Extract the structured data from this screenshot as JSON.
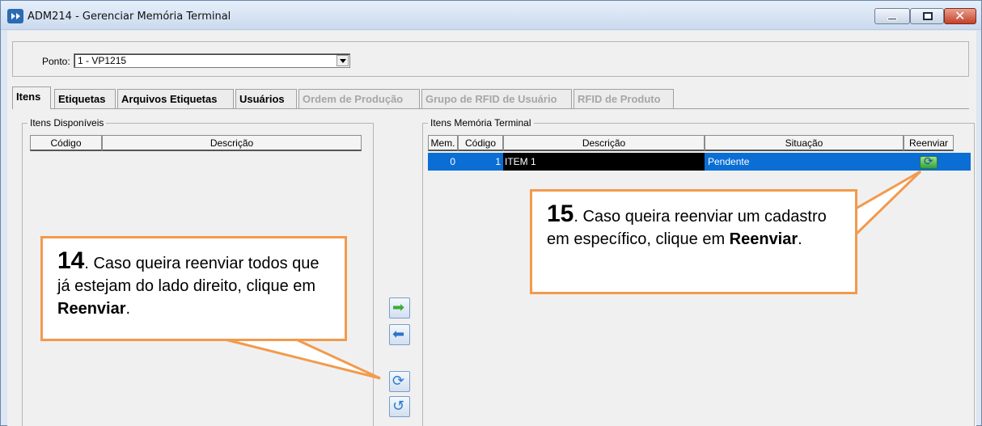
{
  "window": {
    "title": "ADM214 - Gerenciar Memória Terminal",
    "buttons": {
      "minimize": "minimize-icon",
      "maximize": "maximize-icon",
      "close": "close-icon"
    }
  },
  "ponto": {
    "label": "Ponto:",
    "selected": "1 - VP1215"
  },
  "tabs": [
    {
      "label": "Itens",
      "active": true,
      "disabled": false
    },
    {
      "label": "Etiquetas",
      "active": false,
      "disabled": false
    },
    {
      "label": "Arquivos Etiquetas",
      "active": false,
      "disabled": false
    },
    {
      "label": "Usuários",
      "active": false,
      "disabled": false
    },
    {
      "label": "Ordem de Produção",
      "active": false,
      "disabled": true
    },
    {
      "label": "Grupo de RFID de Usuário",
      "active": false,
      "disabled": true
    },
    {
      "label": "RFID de Produto",
      "active": false,
      "disabled": true
    }
  ],
  "left_panel": {
    "title": "Itens Disponíveis",
    "columns": [
      "Código",
      "Descrição"
    ],
    "rows": []
  },
  "right_panel": {
    "title": "Itens Memória Terminal",
    "columns": [
      "Mem.",
      "Código",
      "Descrição",
      "Situação",
      "Reenviar"
    ],
    "rows": [
      {
        "mem": "0",
        "codigo": "1",
        "descricao": "ITEM 1",
        "situacao": "Pendente",
        "reenviar_icon": "resend-icon"
      }
    ]
  },
  "middle_buttons": [
    {
      "name": "add-button",
      "icon": "arrow-right-icon",
      "glyph": "➡"
    },
    {
      "name": "remove-button",
      "icon": "arrow-left-icon",
      "glyph": "⬅"
    },
    {
      "name": "resend-all-button",
      "icon": "sync-icon",
      "glyph": "⟳"
    },
    {
      "name": "return-button",
      "icon": "return-icon",
      "glyph": "↺"
    }
  ],
  "callouts": {
    "c14": {
      "num": "14",
      "pre": ". Caso queira reenviar todos que já estejam do lado direito, clique em ",
      "bold": "Reenviar",
      "post": "."
    },
    "c15": {
      "num": "15",
      "pre": ". Caso queira reenviar um cadastro em específico, clique em ",
      "bold": "Reenviar",
      "post": "."
    }
  },
  "colors": {
    "accent_callout": "#f29a4d",
    "selection": "#0a6ed4"
  }
}
